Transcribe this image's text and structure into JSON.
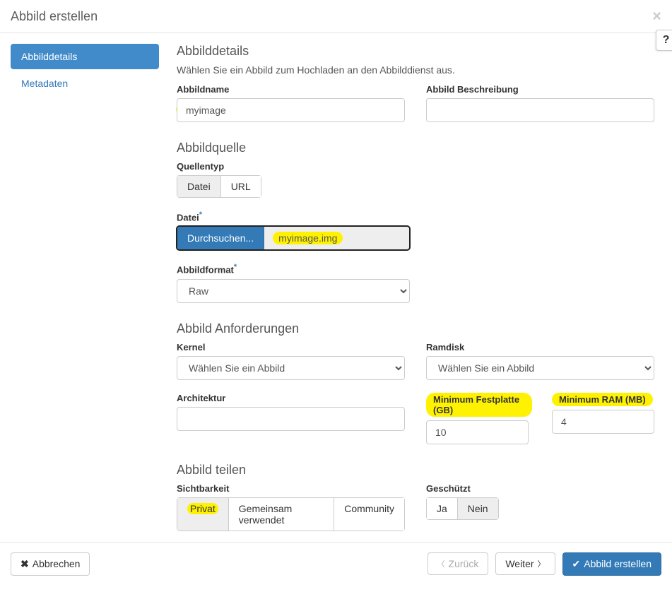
{
  "header": {
    "title": "Abbild erstellen"
  },
  "sidebar": {
    "items": [
      {
        "label": "Abbilddetails",
        "active": true
      },
      {
        "label": "Metadaten",
        "active": false
      }
    ]
  },
  "details": {
    "section_title": "Abbilddetails",
    "description": "Wählen Sie ein Abbild zum Hochladen an den Abbilddienst aus.",
    "name_label": "Abbildname",
    "name_value": "myimage",
    "desc_label": "Abbild Beschreibung",
    "desc_value": ""
  },
  "source": {
    "section_title": "Abbildquelle",
    "type_label": "Quellentyp",
    "type_options": {
      "file": "Datei",
      "url": "URL"
    },
    "type_selected": "file",
    "file_label": "Datei",
    "browse_label": "Durchsuchen...",
    "file_name": "myimage.img",
    "format_label": "Abbildformat",
    "format_value": "Raw"
  },
  "requirements": {
    "section_title": "Abbild Anforderungen",
    "kernel_label": "Kernel",
    "kernel_value": "Wählen Sie ein Abbild",
    "ramdisk_label": "Ramdisk",
    "ramdisk_value": "Wählen Sie ein Abbild",
    "arch_label": "Architektur",
    "arch_value": "",
    "mindisk_label": "Minimum Festplatte (GB)",
    "mindisk_value": "10",
    "minram_label": "Minimum RAM (MB)",
    "minram_value": "4"
  },
  "sharing": {
    "section_title": "Abbild teilen",
    "visibility_label": "Sichtbarkeit",
    "visibility_options": {
      "private": "Privat",
      "shared": "Gemeinsam verwendet",
      "community": "Community"
    },
    "visibility_selected": "private",
    "protected_label": "Geschützt",
    "protected_options": {
      "yes": "Ja",
      "no": "Nein"
    },
    "protected_selected": "no"
  },
  "footer": {
    "cancel": "Abbrechen",
    "back": "Zurück",
    "next": "Weiter",
    "submit": "Abbild erstellen"
  }
}
